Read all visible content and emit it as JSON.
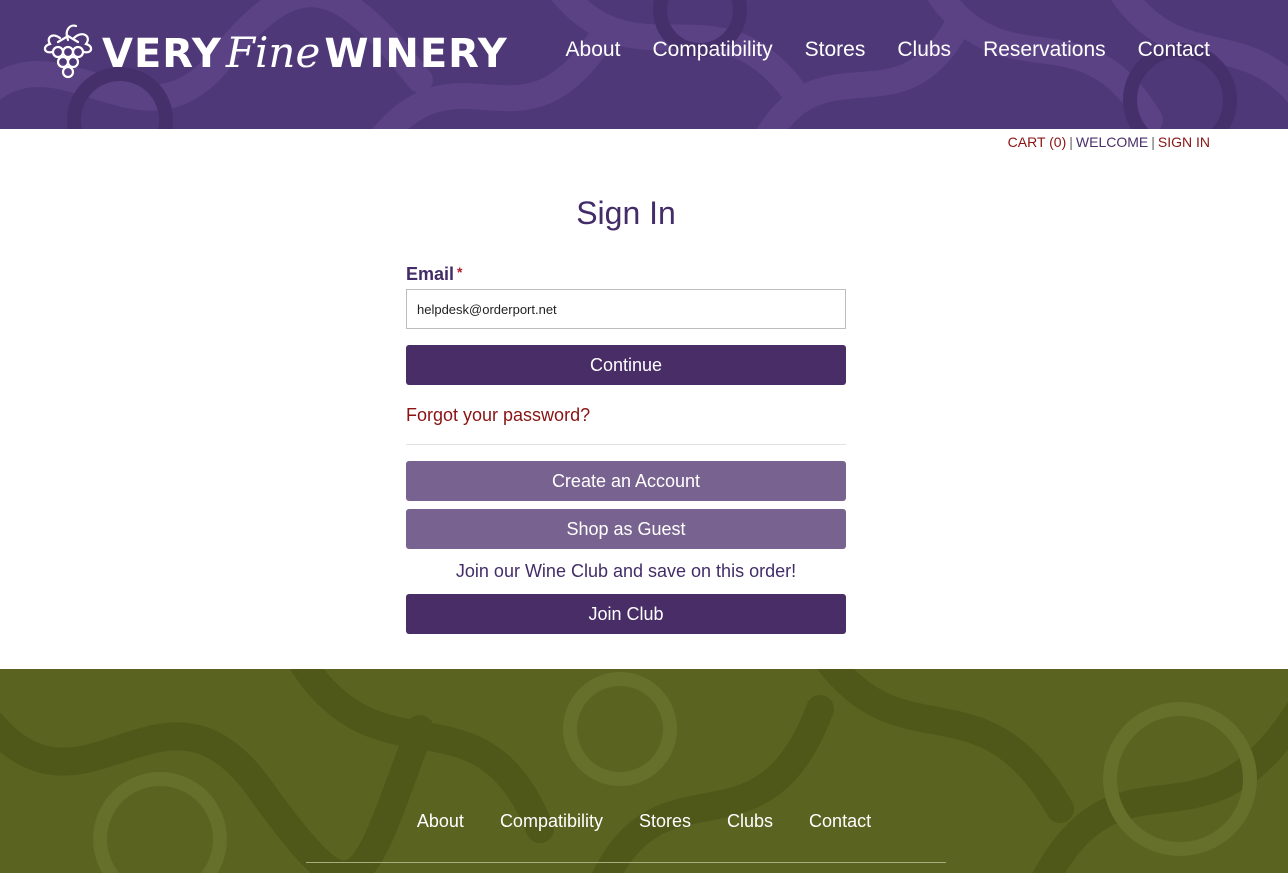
{
  "brand": {
    "very": "VERY",
    "fine": "Fine",
    "winery": "WINERY",
    "icon": "grape-vine-icon",
    "header_color": "#4f3878",
    "footer_color": "#5a6320",
    "button_dark": "#482d66",
    "button_light": "#78628f",
    "link_color": "#8a1414"
  },
  "nav": {
    "items": [
      {
        "label": "About"
      },
      {
        "label": "Compatibility"
      },
      {
        "label": "Stores"
      },
      {
        "label": "Clubs"
      },
      {
        "label": "Reservations"
      },
      {
        "label": "Contact"
      }
    ]
  },
  "utility": {
    "cart": "CART (0)",
    "separator": "|",
    "welcome": "WELCOME",
    "sign_in": "SIGN IN"
  },
  "signin": {
    "title": "Sign In",
    "email_label": "Email",
    "required_mark": "*",
    "email_value": "helpdesk@orderport.net",
    "continue_label": "Continue",
    "forgot_label": "Forgot your password?",
    "create_label": "Create an Account",
    "guest_label": "Shop as Guest",
    "club_text": "Join our Wine Club and save on this order!",
    "join_label": "Join Club"
  },
  "footer": {
    "items": [
      {
        "label": "About"
      },
      {
        "label": "Compatibility"
      },
      {
        "label": "Stores"
      },
      {
        "label": "Clubs"
      },
      {
        "label": "Contact"
      }
    ]
  }
}
